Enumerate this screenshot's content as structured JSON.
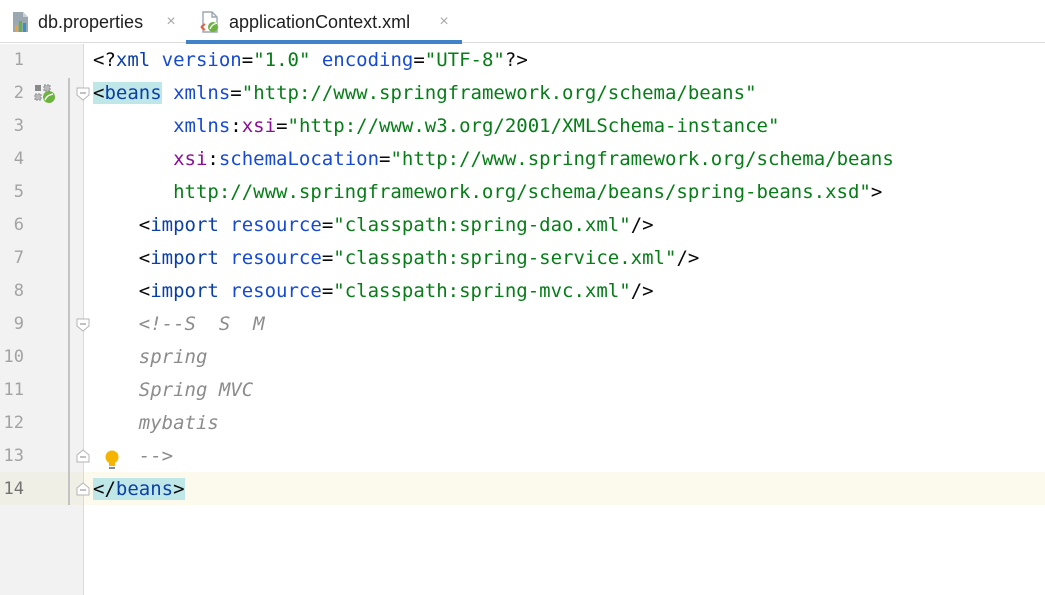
{
  "tabs": [
    {
      "label": "db.properties",
      "close": "×",
      "icon": "properties-file-icon",
      "active": false
    },
    {
      "label": "applicationContext.xml",
      "close": "×",
      "icon": "spring-xml-file-icon",
      "active": true
    }
  ],
  "gutter": {
    "line_numbers": [
      "1",
      "2",
      "3",
      "4",
      "5",
      "6",
      "7",
      "8",
      "9",
      "10",
      "11",
      "12",
      "13",
      "14"
    ],
    "current_line": "14"
  },
  "code": {
    "l1": {
      "a": "<?",
      "b": "xml",
      "c": " version",
      "d": "=",
      "e": "\"1.0\"",
      "f": " encoding",
      "g": "=",
      "h": "\"UTF-8\"",
      "i": "?>"
    },
    "l2": {
      "a": "<",
      "b": "beans",
      "c": " xmlns",
      "d": "=",
      "e": "\"http://www.springframework.org/schema/beans\""
    },
    "l3": {
      "indent": "       ",
      "ns": "xmlns",
      "sep": ":",
      "attr": "xsi",
      "eq": "=",
      "val": "\"http://www.w3.org/2001/XMLSchema-instance\""
    },
    "l4": {
      "indent": "       ",
      "ns": "xsi",
      "sep": ":",
      "attr": "schemaLocation",
      "eq": "=",
      "val": "\"http://www.springframework.org/schema/beans"
    },
    "l5": {
      "indent": "       ",
      "val": "http://www.springframework.org/schema/beans/spring-beans.xsd\"",
      "close": ">"
    },
    "l6": {
      "indent": "    ",
      "lt": "<",
      "tag": "import",
      "attr": " resource",
      "eq": "=",
      "val": "\"classpath:spring-dao.xml\"",
      "close": "/>"
    },
    "l7": {
      "indent": "    ",
      "lt": "<",
      "tag": "import",
      "attr": " resource",
      "eq": "=",
      "val": "\"classpath:spring-service.xml\"",
      "close": "/>"
    },
    "l8": {
      "indent": "    ",
      "lt": "<",
      "tag": "import",
      "attr": " resource",
      "eq": "=",
      "val": "\"classpath:spring-mvc.xml\"",
      "close": "/>"
    },
    "l9": {
      "indent": "    ",
      "cmt": "<!--S  S  M"
    },
    "l10": {
      "indent": "    ",
      "cmt": "spring"
    },
    "l11": {
      "indent": "    ",
      "cmt": "Spring MVC"
    },
    "l12": {
      "indent": "    ",
      "cmt": "mybatis"
    },
    "l13": {
      "indent": "    ",
      "cmt": "-->"
    },
    "l14": {
      "a": "</",
      "b": "beans",
      "c": ">"
    }
  },
  "colors": {
    "tag": "#0a3fa8",
    "attribute": "#174ad4",
    "namespace": "#871094",
    "string": "#067d17",
    "comment": "#8c8c8c",
    "tab_underline": "#4083c9",
    "brace_match": "#bfe7e7"
  }
}
